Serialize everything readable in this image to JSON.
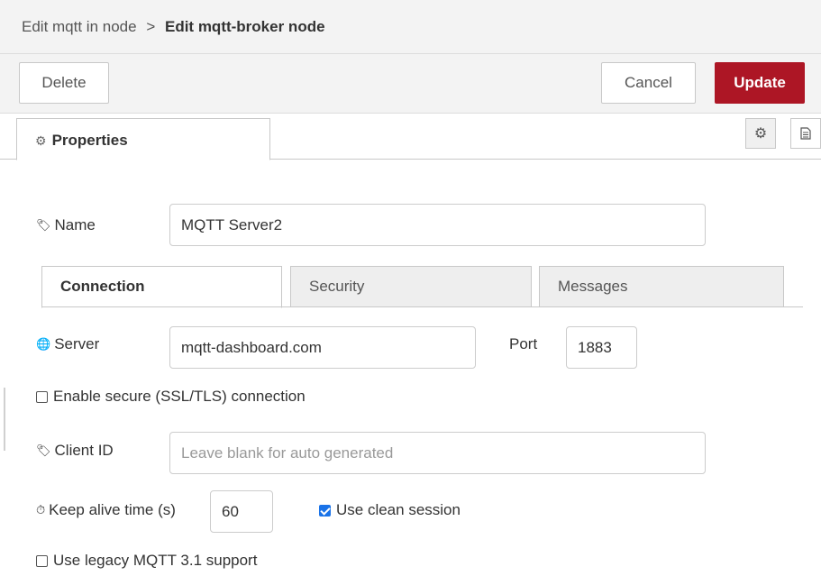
{
  "breadcrumb": {
    "parent": "Edit mqtt in node",
    "separator": ">",
    "current": "Edit mqtt-broker node"
  },
  "toolbar": {
    "delete_label": "Delete",
    "cancel_label": "Cancel",
    "update_label": "Update"
  },
  "tabs": {
    "properties_label": "Properties"
  },
  "name_field": {
    "label": "Name",
    "value": "MQTT Server2"
  },
  "subtabs": {
    "connection": "Connection",
    "security": "Security",
    "messages": "Messages"
  },
  "server_field": {
    "label": "Server",
    "value": "mqtt-dashboard.com"
  },
  "port_field": {
    "label": "Port",
    "value": "1883"
  },
  "ssl_checkbox": {
    "label": "Enable secure (SSL/TLS) connection",
    "checked": false
  },
  "client_id_field": {
    "label": "Client ID",
    "placeholder": "Leave blank for auto generated"
  },
  "keepalive_field": {
    "label": "Keep alive time (s)",
    "value": "60"
  },
  "clean_session_checkbox": {
    "label": "Use clean session",
    "checked": true
  },
  "legacy_checkbox": {
    "label": "Use legacy MQTT 3.1 support",
    "checked": false
  },
  "colors": {
    "accent": "#ad1625",
    "checkbox_checked": "#1a73e8"
  }
}
